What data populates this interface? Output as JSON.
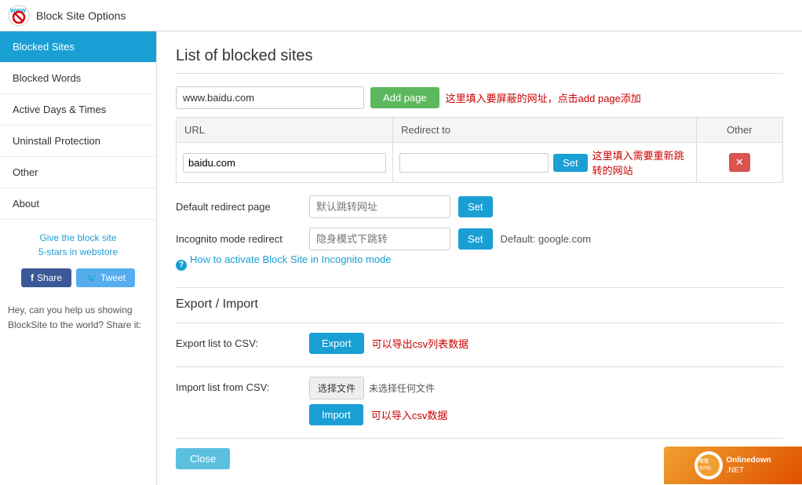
{
  "app": {
    "title": "Block Site Options"
  },
  "sidebar": {
    "items": [
      {
        "id": "blocked-sites",
        "label": "Blocked Sites",
        "active": true
      },
      {
        "id": "blocked-words",
        "label": "Blocked Words",
        "active": false
      },
      {
        "id": "active-days-times",
        "label": "Active Days & Times",
        "active": false
      },
      {
        "id": "uninstall-protection",
        "label": "Uninstall Protection",
        "active": false
      },
      {
        "id": "other",
        "label": "Other",
        "active": false
      },
      {
        "id": "about",
        "label": "About",
        "active": false
      }
    ],
    "promo_line1": "Give the block site",
    "promo_line2": "5-stars in webstore",
    "social_share": "Hey, can you help us showing BlockSite to the world? Share it:",
    "btn_share": "Share",
    "btn_tweet": "Tweet"
  },
  "main": {
    "page_title": "List of blocked sites",
    "add_site_placeholder": "www.baidu.com",
    "add_site_hint": "这里填入要屏蔽的网址，点击add page添加",
    "btn_add_page": "Add page",
    "table": {
      "col_url": "URL",
      "col_redirect": "Redirect to",
      "col_other": "Other",
      "rows": [
        {
          "url": "baidu.com",
          "redirect": "",
          "redirect_hint": "这里填入需要重新跳转的网站"
        }
      ]
    },
    "default_redirect_label": "Default redirect page",
    "default_redirect_placeholder": "默认跳转网址",
    "btn_set_default": "Set",
    "incognito_label": "Incognito mode redirect",
    "incognito_placeholder": "隐身模式下跳转",
    "btn_set_incognito": "Set",
    "incognito_default": "Default: google.com",
    "incognito_link": "How to activate Block Site in Incognito mode",
    "section_export_import": "Export / Import",
    "export_label": "Export list to CSV:",
    "btn_export": "Export",
    "export_hint": "可以导出csv列表数据",
    "import_label": "Import list from CSV:",
    "btn_choose_file": "选择文件",
    "file_name": "未选择任何文件",
    "btn_import": "Import",
    "import_hint": "可以导入csv数据",
    "btn_close": "Close"
  }
}
